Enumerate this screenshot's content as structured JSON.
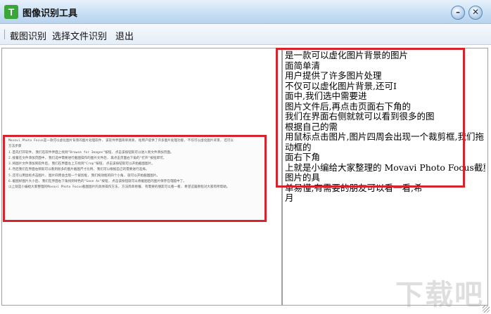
{
  "window": {
    "icon_letter": "T",
    "title": "图像识别工具",
    "minimize_symbol": "–",
    "close_symbol": "✕"
  },
  "menu": {
    "items": [
      "截图识别",
      "选择文件识别",
      "退出"
    ]
  },
  "image_pane": {
    "lines": [
      "Movavi Photo Focus是一款可以虚化图片背景的图片处理软件, 该软件界面简单清爽, 给用户提供了许多图片处理功能, 不仅可以虚化图片背景, 还可以",
      "方法步骤",
      "1.首先打开软件, 我们在软件界面上找到\"Browse for Images\"按钮, 点击该按钮就可以进入到文件添加页面。",
      "2.接着在文件添加页面中, 我们选中需要进行截图操作的图片文件后, 再点击页面右下角的\"打开\"按钮即可。",
      "3.将图片文件添加到软件后, 我们在界面左上方找到\"Crop\"按钮, 点击该按钮就可以开始截图图片。",
      "4.然后我们在界面右侧就可以看到很多的图片截图尺寸比例, 我们可以根据自己的需要进行选择。",
      "5.还可以用鼠标点击图片, 图片四周会出现一个裁剪框, 我们拖动框的四个小角, 就可以开始截图图片。",
      "6.截图好图片大小后, 我们在界面右下角找到绿色的\"Save As\"按钮, 点击该按钮就可以将截图后的图片保存在电脑中了。",
      "以上就是小编给大家整理的Movavi Photo Focus截图图片的具体操作方法, 方法简单易懂, 有需要的朋友可以看一看, 希望这篇教程对大家有所帮助。"
    ]
  },
  "result_pane": {
    "lines": [
      "是一款可以虚化图片背景的图片",
      "面简单清",
      "用户提供了许多图片处理",
      "不仅可以虚化图片背景,还可I",
      "面中,我们选中需要进",
      "图片文件后,再点击页面右下角的",
      "我们在界面右侧就就可以看到很多的图",
      "根据自己的需",
      "用鼠标点击图片,图片四周会出现一个裁剪框,我们拖",
      "动框的",
      "面右下角",
      "上就是小编给大家整理的 Movavi Photo Focus截剪",
      "图片的具",
      "单易懂,有需要的朋友可以看一看,希",
      "月"
    ]
  },
  "watermark": "下载吧",
  "colors": {
    "highlight_box": "#d7232b",
    "icon_bg": "#3ba43b"
  }
}
